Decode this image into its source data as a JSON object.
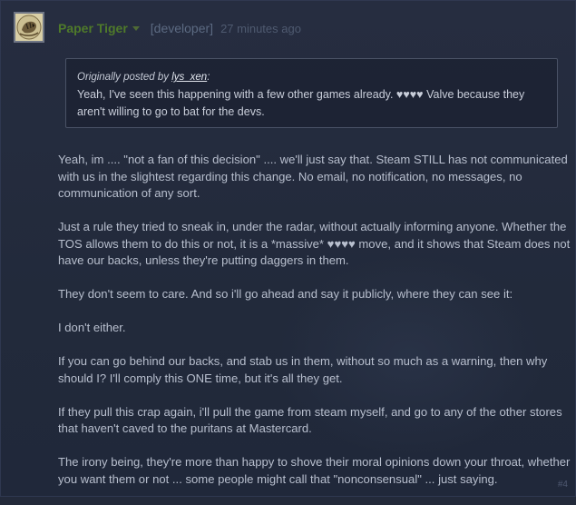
{
  "post": {
    "author": "Paper Tiger",
    "role": "[developer]",
    "timestamp": "27 minutes ago",
    "quote": {
      "prefix": "Originally posted by",
      "user": "lys_xen",
      "suffix": ":",
      "text": "Yeah, I've seen this happening with a few other games already. ♥♥♥♥ Valve because they aren't willing to go to bat for the devs."
    },
    "paragraphs": [
      "Yeah, im .... \"not a fan of this decision\" .... we'll just say that. Steam STILL has not communicated with us in the slightest regarding this change. No email, no notification, no messages, no communication of any sort.",
      "Just a rule they tried to sneak in, under the radar, without actually informing anyone. Whether the TOS allows them to do this or not, it is a *massive* ♥♥♥♥ move, and it shows that Steam does not have our backs, unless they're putting daggers in them.",
      "They don't seem to care. And so i'll go ahead and say it publicly, where they can see it:",
      "I don't either.",
      "If you can go behind our backs, and stab us in them, without so much as a warning, then why should I? I'll comply this ONE time, but it's all they get.",
      "If they pull this crap again, i'll pull the game from steam myself, and go to any of the other stores that haven't caved to the puritans at Mastercard.",
      "The irony being, they're more than happy to shove their moral opinions down your throat, whether you want them or not ... some people might call that \"nonconsensual\" ... just saying."
    ],
    "post_number": "#4"
  },
  "icons": {
    "avatar": "tiger-avatar-icon",
    "dropdown": "chevron-down-icon"
  },
  "colors": {
    "background": "#232a3a",
    "author": "#4f7a2a",
    "body_text": "#b8bfce",
    "quote_border": "#4a5266"
  }
}
